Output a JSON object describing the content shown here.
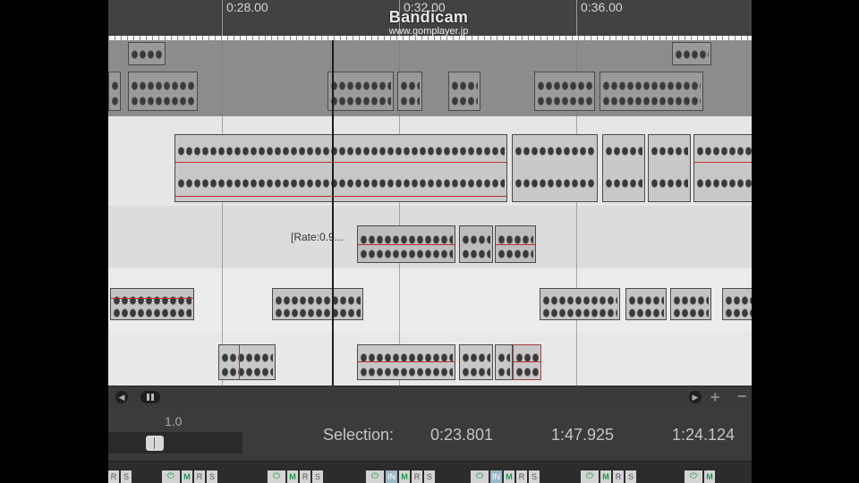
{
  "watermark": {
    "title": "Bandicam",
    "url": "www.gomplayer.jp"
  },
  "ruler": {
    "ticks": [
      "0:28.00",
      "0:32.00",
      "0:36.00"
    ]
  },
  "items": {
    "rate_label": "[Rate:0.9..."
  },
  "transport": {
    "rate_value": "1.0"
  },
  "selection": {
    "label": "Selection:",
    "start": "0:23.801",
    "end": "1:47.925",
    "length": "1:24.124"
  },
  "mixer": {
    "power_icon": "power-icon",
    "mute": "M",
    "record": "R",
    "solo": "S",
    "input": "IN"
  },
  "colors": {
    "ruler_bg": "#424242",
    "lane_dark": "#8c8c8c",
    "lane_light": "#e6e6e6",
    "item_fill": "#c8c8c8",
    "item_red": "#c03030",
    "mute_green": "#1a9a4a"
  }
}
